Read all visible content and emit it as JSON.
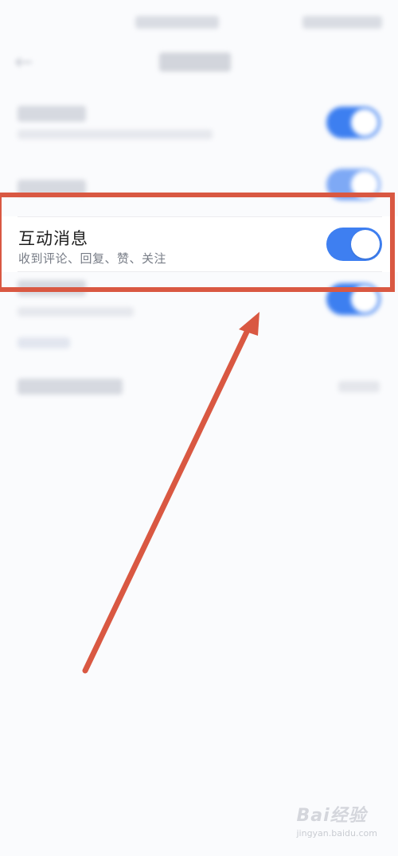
{
  "focused_setting": {
    "title": "互动消息",
    "subtitle": "收到评论、回复、赞、关注",
    "enabled": true
  },
  "colors": {
    "toggle_on": "#3e7ff1",
    "highlight": "#d95842",
    "background": "#fafbfd"
  },
  "icons": {
    "back": "back-arrow-icon"
  },
  "watermark": {
    "text": "Bai经验",
    "sub": "jingyan.baidu.com"
  }
}
